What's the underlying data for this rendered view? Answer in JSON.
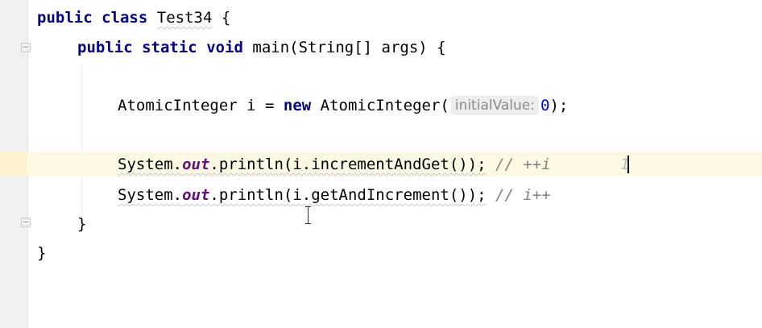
{
  "editor": {
    "lines": {
      "class_decl": {
        "kw_public": "public",
        "kw_class": "class",
        "class_name": "Test34",
        "brace": "{"
      },
      "main_decl": {
        "kw_public": "public",
        "kw_static": "static",
        "kw_void": "void",
        "rest": "main(String[] args) {"
      },
      "atomic_decl": {
        "type_and_var": "AtomicInteger i = ",
        "kw_new": "new",
        "ctor_open": " AtomicInteger(",
        "param_hint": "initialValue:",
        "arg": "0",
        "tail": ");"
      },
      "println_inc": {
        "prefix": "System.",
        "field": "out",
        "call": ".println(i.incrementAndGet());",
        "comment": "// ++i",
        "trailing_char": "1"
      },
      "println_get": {
        "prefix": "System.",
        "field": "out",
        "call": ".println(i.getAndIncrement());",
        "comment": "// i++"
      },
      "main_close": "}",
      "class_close": "}"
    }
  }
}
